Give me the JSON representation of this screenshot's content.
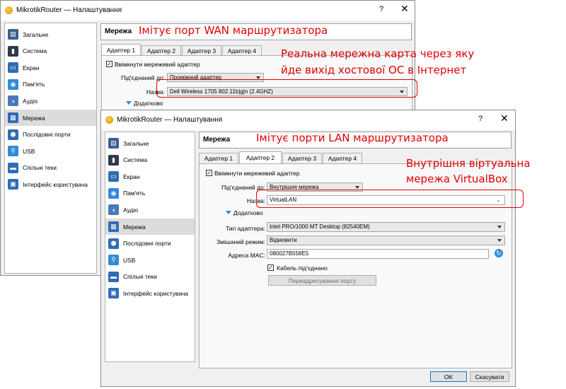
{
  "window_back": {
    "title": "MikrotikRouter — Налаштування",
    "help_icon": "?",
    "close_icon": "✕",
    "sidebar": [
      {
        "label": "Загальне",
        "icon": "general-icon",
        "color": "#3b5f8f"
      },
      {
        "label": "Система",
        "icon": "system-icon",
        "color": "#2d3a48"
      },
      {
        "label": "Екран",
        "icon": "display-icon",
        "color": "#2f6db5"
      },
      {
        "label": "Пам'ять",
        "icon": "storage-icon",
        "color": "#2f8bd8"
      },
      {
        "label": "Аудіо",
        "icon": "audio-icon",
        "color": "#4a78b8"
      },
      {
        "label": "Мережа",
        "icon": "network-icon",
        "color": "#2f6db5",
        "selected": true
      },
      {
        "label": "Послідовні порти",
        "icon": "serial-ports-icon",
        "color": "#2f6db5"
      },
      {
        "label": "USB",
        "icon": "usb-icon",
        "color": "#2f8bd8"
      },
      {
        "label": "Спільні теки",
        "icon": "shared-folders-icon",
        "color": "#2f6db5"
      },
      {
        "label": "Інтерфейс користувача",
        "icon": "user-interface-icon",
        "color": "#2f6db5"
      }
    ],
    "section_title": "Мережа",
    "tabs": [
      "Адаптер 1",
      "Адаптер 2",
      "Адаптер 3",
      "Адаптер 4"
    ],
    "enable_adapter": "Ввімкнути мережевий адаптер",
    "attached_label": "Під'єднаний до:",
    "attached_value": "Проміжний адаптер",
    "name_label": "Назва:",
    "name_value": "Dell Wireless 1705 802.11b|g|n (2.4GHZ)",
    "advanced": "Додатково"
  },
  "window_front": {
    "title": "MikrotikRouter — Налаштування",
    "help_icon": "?",
    "close_icon": "✕",
    "sidebar": [
      {
        "label": "Загальне",
        "icon": "general-icon",
        "color": "#3b5f8f"
      },
      {
        "label": "Система",
        "icon": "system-icon",
        "color": "#2d3a48"
      },
      {
        "label": "Екран",
        "icon": "display-icon",
        "color": "#2f6db5"
      },
      {
        "label": "Пам'ять",
        "icon": "storage-icon",
        "color": "#2f8bd8"
      },
      {
        "label": "Аудіо",
        "icon": "audio-icon",
        "color": "#4a78b8"
      },
      {
        "label": "Мережа",
        "icon": "network-icon",
        "color": "#2f6db5",
        "selected": true
      },
      {
        "label": "Послідовні порти",
        "icon": "serial-ports-icon",
        "color": "#2f6db5"
      },
      {
        "label": "USB",
        "icon": "usb-icon",
        "color": "#2f8bd8"
      },
      {
        "label": "Спільні теки",
        "icon": "shared-folders-icon",
        "color": "#2f6db5"
      },
      {
        "label": "Інтерфейс користувача",
        "icon": "user-interface-icon",
        "color": "#2f6db5"
      }
    ],
    "section_title": "Мережа",
    "tabs": [
      "Адаптер 1",
      "Адаптер 2",
      "Адаптер 3",
      "Адаптер 4"
    ],
    "enable_adapter": "Ввімкнути мережевий адаптер",
    "attached_label": "Під'єднаний до:",
    "attached_value": "Внутрішня мережа",
    "name_label": "Назва:",
    "name_value": "VirtualLAN",
    "advanced": "Додатково",
    "adapter_type_label": "Тип адаптера:",
    "adapter_type_value": "Intel PRO/1000 MT Desktop (82540EM)",
    "promisc_label": "Змішаний режим:",
    "promisc_value": "Відмовити",
    "mac_label": "Адреса MAC:",
    "mac_value": "080027B558E5",
    "cable_connected": "Кабель під'єднано",
    "port_forwarding": "Переадресування порту",
    "ok": "OK",
    "cancel": "Скасувати"
  },
  "annotations": {
    "wan": "Імітує порт WAN маршрутизатора",
    "real_nic_line1": "Реальна мережна карта через яку",
    "real_nic_line2": "йде вихід хостової ОС в Інтернет",
    "lan": "Імітує порти LAN маршрутизатора",
    "internal_line1": "Внутрішня віртуальна",
    "internal_line2": "мережа VirtualBox"
  },
  "colors": {
    "annotation": "#e00000",
    "selection": "#dcdcdc",
    "accent": "#2f6db5"
  }
}
